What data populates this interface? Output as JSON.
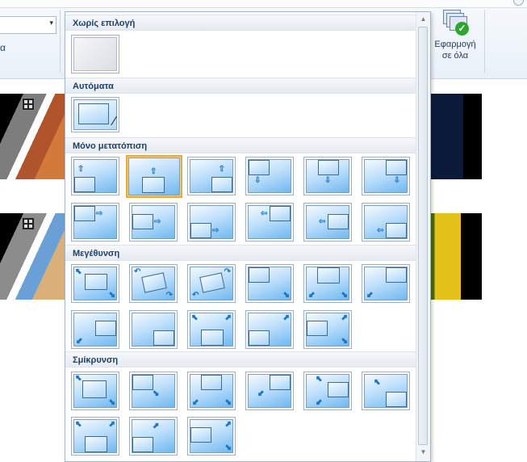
{
  "ribbon": {
    "left_fragment": "α",
    "apply_all_line1": "Εφαρμογή",
    "apply_all_line2": "σε όλα",
    "apply_icon": "stack-check-icon"
  },
  "gallery": {
    "categories": {
      "none": "Χωρίς επιλογή",
      "automatic": "Αυτόματα",
      "pan": "Μόνο μετατόπιση",
      "zoom_in": "Μεγέθυνση",
      "zoom_out": "Σμίκρυνση"
    },
    "selected_item": "pan-2",
    "scroll_up_icon": "scroll-up-arrow-icon",
    "scroll_down_icon": "scroll-down-arrow-icon"
  },
  "colors": {
    "selection_border": "#e8a840",
    "header_text": "#1e3f66",
    "tile_blue": "#6fb8f1"
  }
}
